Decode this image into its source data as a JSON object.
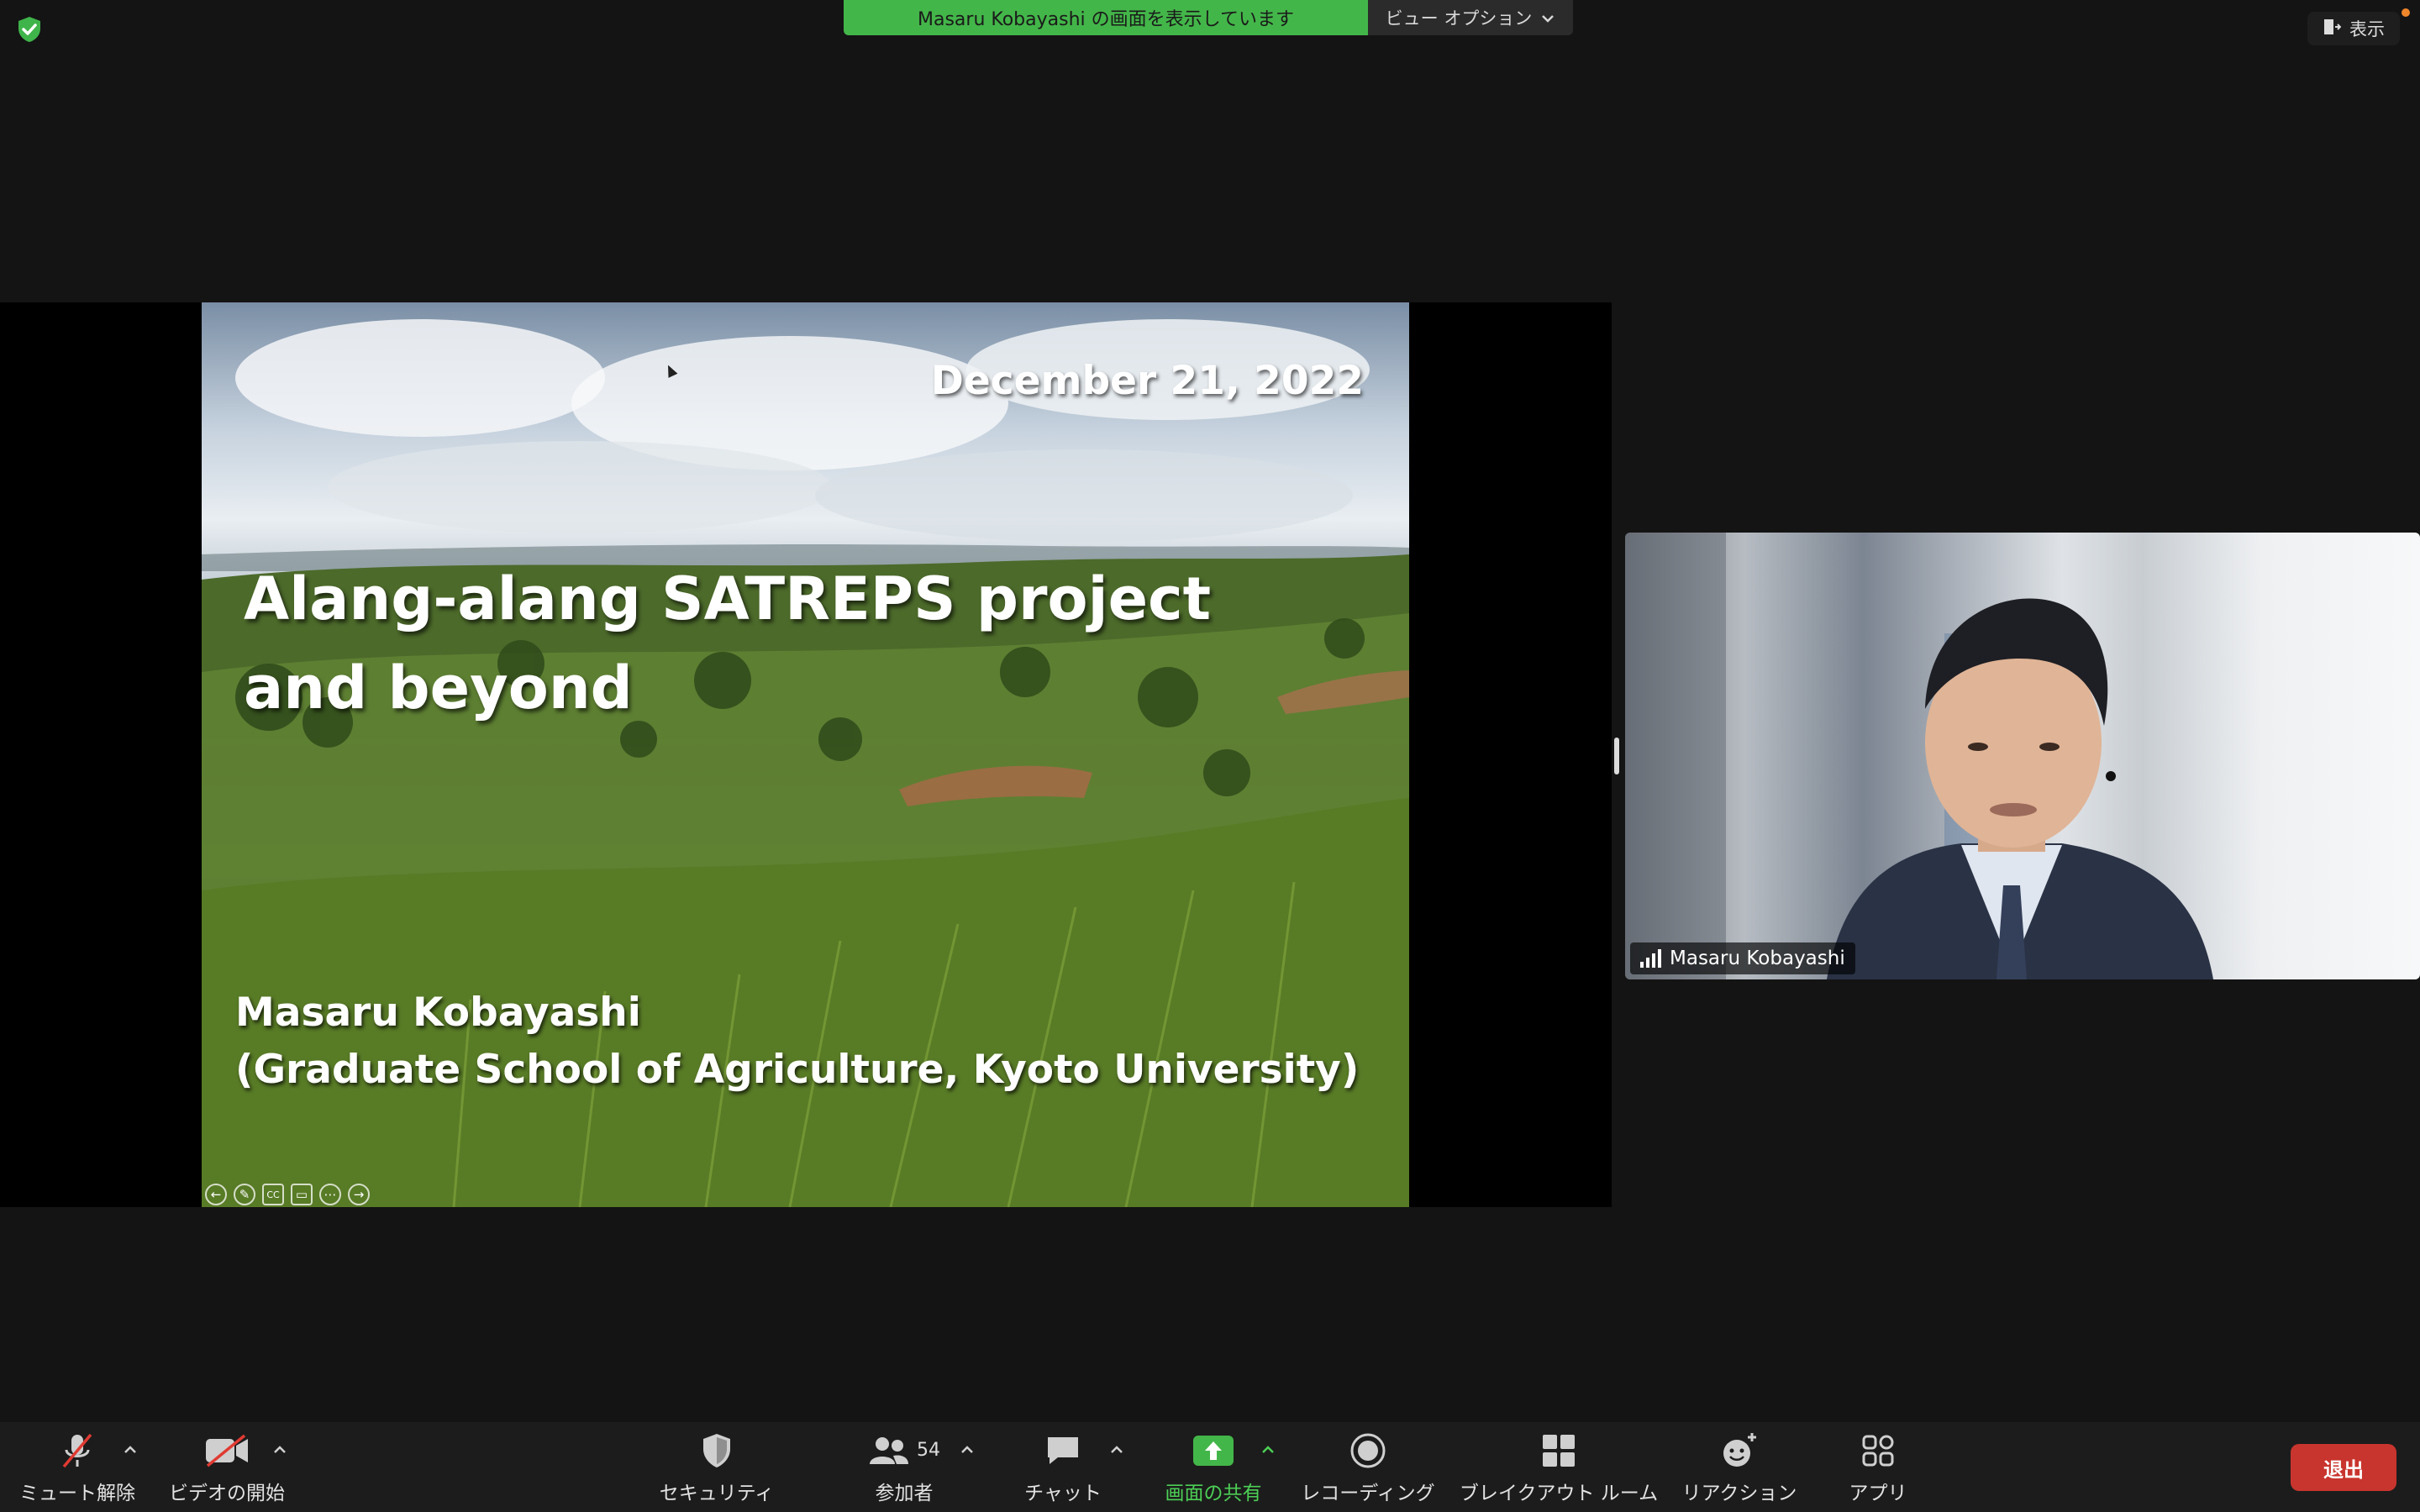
{
  "top": {
    "share_banner": "Masaru Kobayashi の画面を表示しています",
    "view_options": "ビュー オプション",
    "view_button": "表示"
  },
  "slide": {
    "date": "December 21, 2022",
    "title_line1": "Alang-alang SATREPS project",
    "title_line2": "and beyond",
    "author_line1": "Masaru Kobayashi",
    "author_line2": "(Graduate School of Agriculture, Kyoto University)",
    "tools": [
      "←",
      "✎",
      "CC",
      "▭",
      "⋯",
      "→"
    ]
  },
  "video": {
    "participant_name": "Masaru Kobayashi"
  },
  "toolbar": {
    "mute": "ミュート解除",
    "video": "ビデオの開始",
    "security": "セキュリティ",
    "participants": "参加者",
    "participants_count": "54",
    "chat": "チャット",
    "share": "画面の共有",
    "recording": "レコーディング",
    "breakout": "ブレイクアウト ルーム",
    "reactions": "リアクション",
    "apps": "アプリ",
    "leave": "退出"
  },
  "colors": {
    "share_green": "#43b649",
    "leave_red": "#c8352e",
    "background": "#141414",
    "toolbar": "#1c1c1c"
  },
  "icons": [
    "shield-check-icon",
    "chevron-down-icon",
    "exit-view-icon",
    "mic-off-icon",
    "video-off-icon",
    "security-shield-icon",
    "participants-icon",
    "chat-icon",
    "share-screen-icon",
    "record-icon",
    "breakout-rooms-icon",
    "reaction-icon",
    "apps-icon",
    "signal-icon"
  ]
}
